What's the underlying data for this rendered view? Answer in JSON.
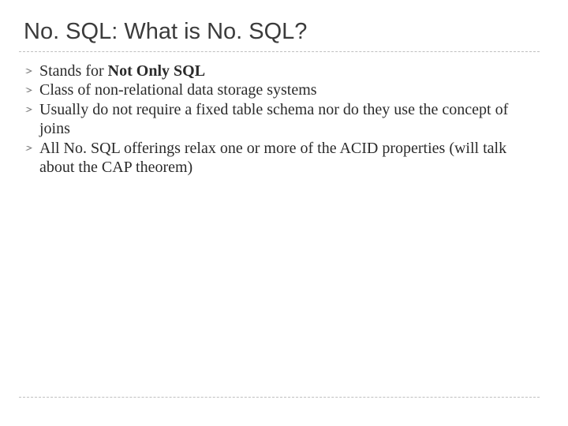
{
  "title": "No. SQL: What is No. SQL?",
  "bullets": [
    {
      "pre": "Stands for ",
      "bold": "Not Only SQL",
      "post": ""
    },
    {
      "pre": "Class of non-relational data storage systems",
      "bold": "",
      "post": ""
    },
    {
      "pre": "Usually do not require a fixed table schema nor do they use the concept of joins",
      "bold": "",
      "post": ""
    },
    {
      "pre": "All No. SQL offerings relax one or more of the ACID properties (will talk about the CAP theorem)",
      "bold": "",
      "post": ""
    }
  ]
}
